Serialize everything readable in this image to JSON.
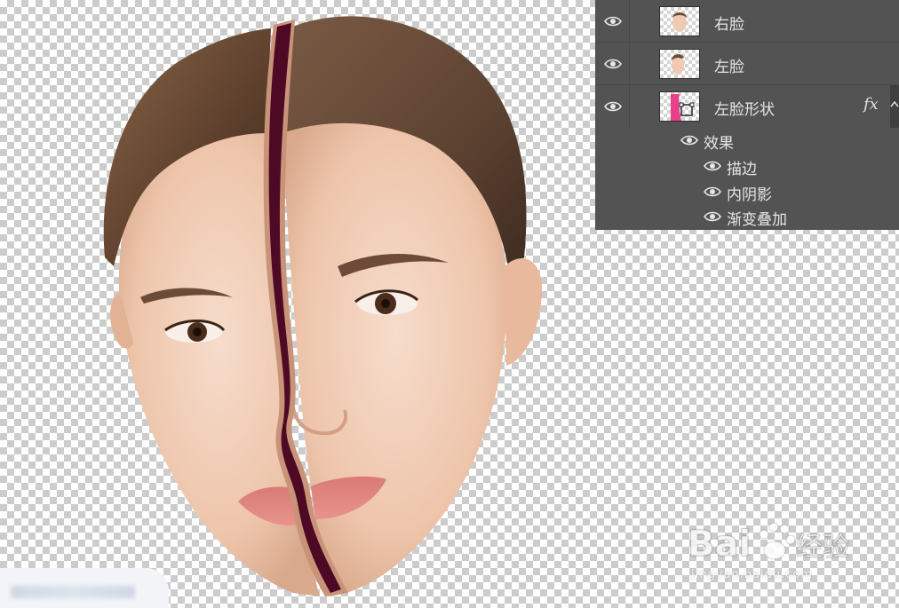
{
  "layers_panel": {
    "layers": [
      {
        "name": "右脸",
        "thumb_icon": "face-right-thumbnail",
        "visibility_icon": "eye-icon"
      },
      {
        "name": "左脸",
        "thumb_icon": "face-left-thumbnail",
        "visibility_icon": "eye-icon"
      },
      {
        "name": "左脸形状",
        "thumb_icon": "shape-thumbnail",
        "visibility_icon": "eye-icon",
        "fx": "fx"
      }
    ],
    "effects_group": "效果",
    "effects": [
      "描边",
      "内阴影",
      "渐变叠加"
    ]
  },
  "watermark": {
    "logo_text": "Bai 经验",
    "url": "jingyan.baidu.com"
  },
  "colors": {
    "panel_bg": "#535353",
    "panel_text": "#e6e6e6",
    "stroke_shape": "#4e0a24",
    "shape_pink": "#e8408a"
  }
}
